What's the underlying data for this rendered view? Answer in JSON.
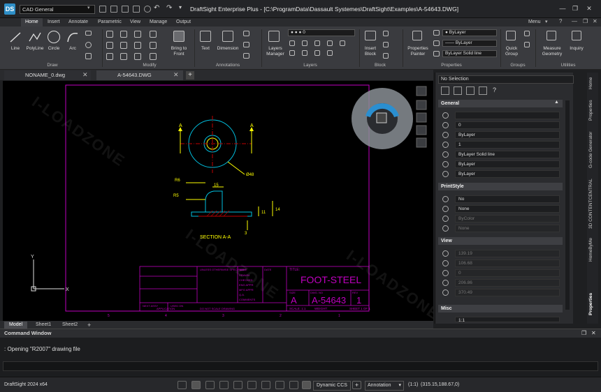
{
  "app": {
    "title": "DraftSight Enterprise Plus - [C:\\ProgramData\\Dassault Systemes\\DraftSight\\Examples\\A-54643.DWG]",
    "logo": "DS",
    "workspace": "CAD General",
    "menu_label": "Menu",
    "version": "DraftSight 2024 x64"
  },
  "ribbon": {
    "tabs": [
      "Home",
      "Insert",
      "Annotate",
      "Parametric",
      "View",
      "Manage",
      "Output"
    ],
    "active_tab": "Home",
    "draw_tools": [
      "Line",
      "PolyLine",
      "Circle",
      "Arc"
    ],
    "modify_tools": [
      "Bring to Front"
    ],
    "annotation_tools": [
      "Text",
      "Dimension"
    ],
    "layers_manager": "Layers Manager",
    "layer_combo": "0",
    "insert_block": "Insert Block",
    "properties_painter": "Properties Painter",
    "bylayer_color": "ByLayer",
    "bylayer_line": "ByLayer",
    "bylayer_weight": "ByLayer",
    "linestyle": "Solid line",
    "quick_group": "Quick Group",
    "measure_geometry": "Measure Geometry",
    "inquiry": "Inquiry",
    "groups": {
      "draw": "Draw",
      "modify": "Modify",
      "annotations": "Annotations",
      "layers": "Layers",
      "block": "Block",
      "properties": "Properties",
      "groups": "Groups",
      "utilities": "Utilities"
    }
  },
  "doc_tabs": [
    "NONAME_0.dwg",
    "A-54643.DWG"
  ],
  "layout_tabs": [
    "Model",
    "Sheet1",
    "Sheet2"
  ],
  "drawing": {
    "section_label": "SECTION A-A",
    "callout_a": "A",
    "dims": {
      "r6": "R6",
      "r5": "R5",
      "d15": "15",
      "d11": "11",
      "d14": "14",
      "d3": "3",
      "d48": "Ø48"
    },
    "titleblock": {
      "title_label": "TITLE:",
      "title": "FOOT-STEEL",
      "size_label": "SIZE",
      "size": "A",
      "dwg_label": "DWG. NO",
      "dwg_no": "A-54643",
      "rev_label": "REV",
      "rev": "1",
      "scale": "SCALE: 1:1",
      "weight": "WEIGHT:",
      "sheet": "SHEET 1 OF 1",
      "company_hint": "UNLESS OTHERWISE SPECIFIED",
      "row_names": [
        "NAME",
        "DATE",
        "DRAWN",
        "CHECKED",
        "ENG APPR",
        "MFG APPR",
        "Q.A.",
        "COMMENTS"
      ],
      "application": "APPLICATION",
      "do_not_scale": "DO NOT SCALE DRAWING",
      "next_assy": "NEXT ASSY",
      "used_on": "USED ON"
    },
    "border_numbers_bottom": [
      "5",
      "4",
      "3",
      "2",
      "1"
    ],
    "ucs_x": "X",
    "ucs_y": "Y"
  },
  "properties": {
    "selection": "No Selection",
    "general": {
      "header": "General",
      "rows": [
        "",
        "0",
        "ByLayer",
        "1",
        "ByLayer    Solid line",
        "ByLayer",
        "ByLayer"
      ]
    },
    "printstyle": {
      "header": "PrintStyle",
      "rows": [
        "No",
        "None",
        "ByColor",
        "None"
      ]
    },
    "view": {
      "header": "View",
      "rows": [
        "139.19",
        "106.68",
        "0",
        "206.86",
        "370.49"
      ]
    },
    "misc": {
      "header": "Misc",
      "rows": [
        "1:1"
      ]
    }
  },
  "side_tabs": [
    "Home",
    "Properties",
    "G-code Generator",
    "3D CONTENTCENTRAL",
    "HomeByMe",
    "Properties"
  ],
  "command_window": {
    "title": "Command Window",
    "line": ": Opening \"R2007\" drawing file"
  },
  "statusbar": {
    "ccs": "Dynamic CCS",
    "annotation": "Annotation",
    "scale": "(1:1)",
    "coords": "(315.15,188.67,0)"
  },
  "watermark": "I-LOADZONE"
}
